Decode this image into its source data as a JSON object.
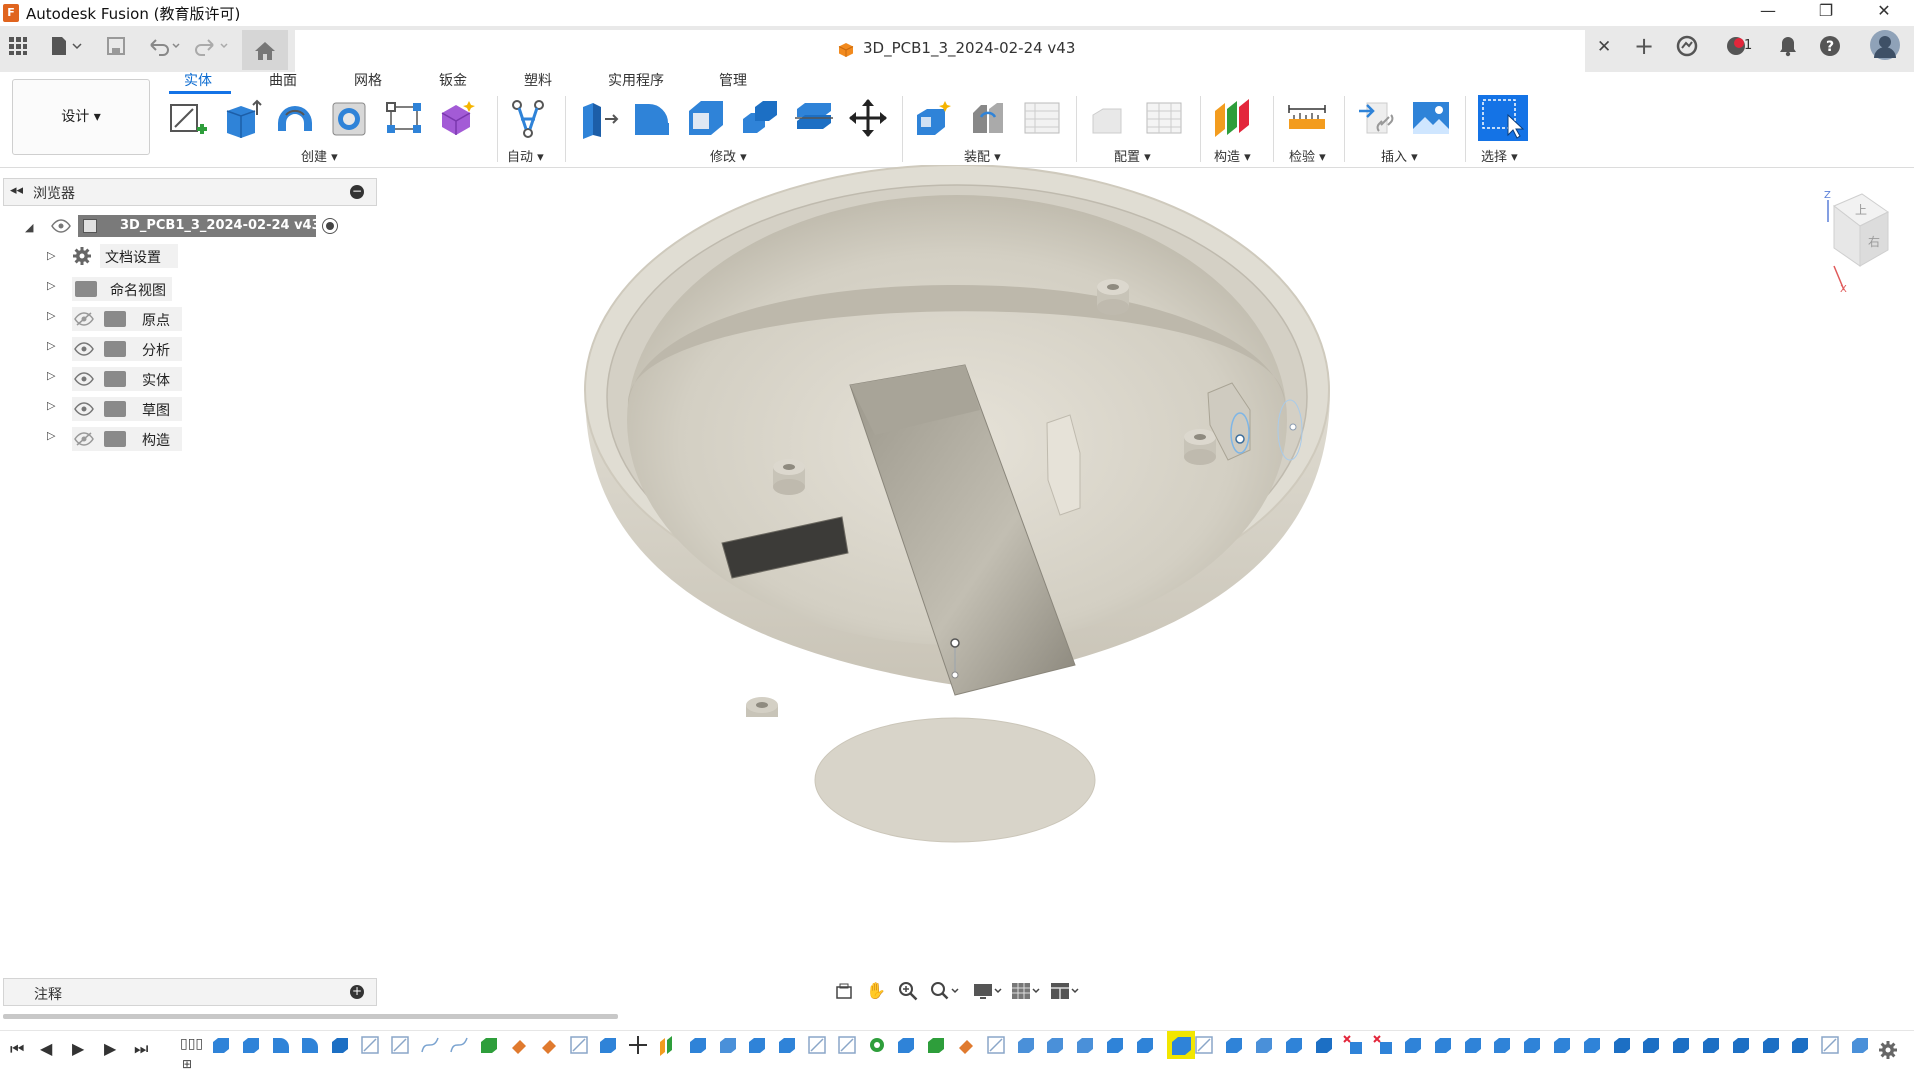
{
  "app": {
    "title": "Autodesk Fusion (教育版许可)",
    "icon_letter": "F",
    "window_controls": {
      "minimize": "—",
      "restore": "❐",
      "close": "✕"
    }
  },
  "document_tab": {
    "title": "3D_PCB1_3_2024-02-24 v43",
    "close": "✕"
  },
  "quick_access": {
    "notifications_count": "1"
  },
  "ribbon": {
    "workspace_label": "设计 ▾",
    "tabs": [
      "实体",
      "曲面",
      "网格",
      "钣金",
      "塑料",
      "实用程序",
      "管理"
    ],
    "active_tab": "实体",
    "groups": {
      "create": "创建 ▾",
      "automate": "自动 ▾",
      "modify": "修改 ▾",
      "assemble": "装配 ▾",
      "configure": "配置 ▾",
      "construct": "构造 ▾",
      "inspect": "检验 ▾",
      "insert": "插入 ▾",
      "select": "选择 ▾"
    }
  },
  "browser": {
    "title": "浏览器",
    "root": "3D_PCB1_3_2024-02-24 v43",
    "items": [
      {
        "label": "文档设置",
        "icon": "gear-icon"
      },
      {
        "label": "命名视图",
        "icon": "folder-icon"
      },
      {
        "label": "原点",
        "icon": "folder-icon",
        "visible": false
      },
      {
        "label": "分析",
        "icon": "folder-icon",
        "visible": true
      },
      {
        "label": "实体",
        "icon": "folder-icon",
        "visible": true
      },
      {
        "label": "草图",
        "icon": "folder-icon",
        "visible": true
      },
      {
        "label": "构造",
        "icon": "folder-icon",
        "visible": false
      }
    ]
  },
  "notes": {
    "title": "注释"
  },
  "viewcube": {
    "top_label": "上",
    "front_label": "右",
    "axis_z": "Z",
    "axis_x": "X"
  },
  "colors": {
    "accent": "#1473e6",
    "model": "#d9d5ca",
    "model_shadow": "#a9a495",
    "tab_bar": "#e9e9e9",
    "timeline_highlight": "#f2e600"
  }
}
